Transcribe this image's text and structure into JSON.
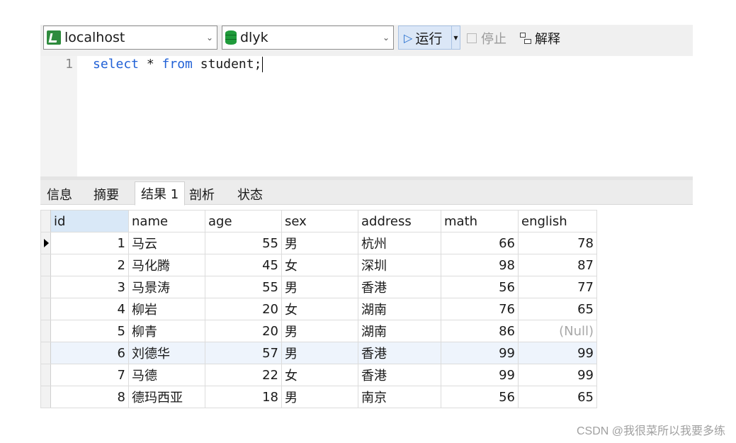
{
  "toolbar": {
    "connection": "localhost",
    "database": "dlyk",
    "run_label": "运行",
    "stop_label": "停止",
    "explain_label": "解释"
  },
  "editor": {
    "line_number": "1",
    "kw_select": "select",
    "star": " * ",
    "kw_from": "from",
    "rest": " student;"
  },
  "tabs": [
    "信息",
    "摘要",
    "结果 1",
    "剖析",
    "状态"
  ],
  "grid": {
    "columns": [
      "id",
      "name",
      "age",
      "sex",
      "address",
      "math",
      "english"
    ],
    "rows": [
      [
        "1",
        "马云",
        "55",
        "男",
        "杭州",
        "66",
        "78"
      ],
      [
        "2",
        "马化腾",
        "45",
        "女",
        "深圳",
        "98",
        "87"
      ],
      [
        "3",
        "马景涛",
        "55",
        "男",
        "香港",
        "56",
        "77"
      ],
      [
        "4",
        "柳岩",
        "20",
        "女",
        "湖南",
        "76",
        "65"
      ],
      [
        "5",
        "柳青",
        "20",
        "男",
        "湖南",
        "86",
        "(Null)"
      ],
      [
        "6",
        "刘德华",
        "57",
        "男",
        "香港",
        "99",
        "99"
      ],
      [
        "7",
        "马德",
        "22",
        "女",
        "香港",
        "99",
        "99"
      ],
      [
        "8",
        "德玛西亚",
        "18",
        "男",
        "南京",
        "56",
        "65"
      ]
    ]
  },
  "watermark": "CSDN @我很菜所以我要多练"
}
